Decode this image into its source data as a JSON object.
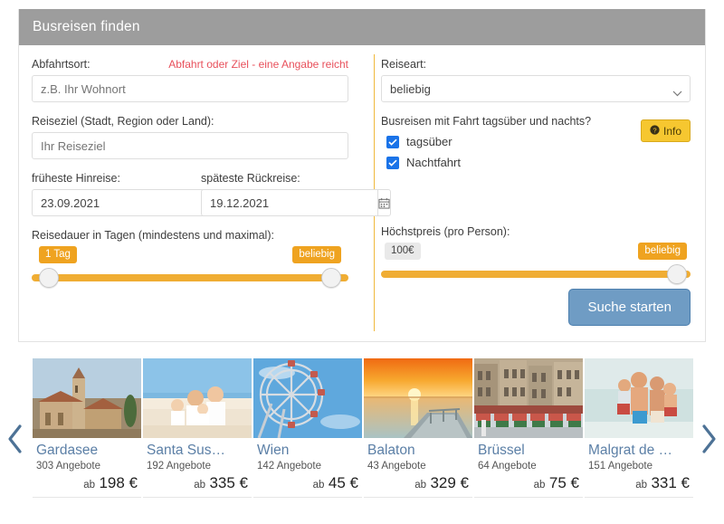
{
  "panel": {
    "header_title": "Busreisen finden"
  },
  "form": {
    "departure": {
      "label": "Abfahrtsort:",
      "warning": "Abfahrt oder Ziel - eine Angabe reicht",
      "placeholder": "z.B. Ihr Wohnort",
      "value": ""
    },
    "destination": {
      "label": "Reiseziel (Stadt, Region oder Land):",
      "placeholder": "Ihr Reiseziel",
      "value": ""
    },
    "date_from": {
      "label": "früheste Hinreise:",
      "value": "23.09.2021",
      "icon": "calendar-icon"
    },
    "date_to": {
      "label": "späteste Rückreise:",
      "value": "19.12.2021",
      "icon": "calendar-icon"
    },
    "duration": {
      "label": "Reisedauer in Tagen (mindestens und maximal):",
      "min_badge": "1 Tag",
      "max_badge": "beliebig"
    },
    "travel_type": {
      "label": "Reiseart:",
      "selected": "beliebig",
      "options": [
        "beliebig"
      ]
    },
    "daynight": {
      "question": "Busreisen mit Fahrt tagsüber und nachts?",
      "options": [
        {
          "label": "tagsüber",
          "checked": true
        },
        {
          "label": "Nachtfahrt",
          "checked": true
        }
      ],
      "info_button": "Info",
      "info_icon": "question-circle-icon"
    },
    "max_price": {
      "label": "Höchstpreis (pro Person):",
      "min_badge": "100€",
      "max_badge": "beliebig"
    },
    "submit_label": "Suche starten"
  },
  "carousel": {
    "prev_icon": "chevron-left-icon",
    "next_icon": "chevron-right-icon",
    "cards": [
      {
        "title": "Gardasee",
        "offers": "303 Angebote",
        "from": "ab",
        "price": "198 €",
        "image": "italian-village-church"
      },
      {
        "title": "Santa Sus…",
        "offers": "192 Angebote",
        "from": "ab",
        "price": "335 €",
        "image": "family-on-beach"
      },
      {
        "title": "Wien",
        "offers": "142 Angebote",
        "from": "ab",
        "price": "45 €",
        "image": "ferris-wheel"
      },
      {
        "title": "Balaton",
        "offers": "43 Angebote",
        "from": "ab",
        "price": "329 €",
        "image": "sunset-pier"
      },
      {
        "title": "Brüssel",
        "offers": "64 Angebote",
        "from": "ab",
        "price": "75 €",
        "image": "grand-place-buildings"
      },
      {
        "title": "Malgrat de …",
        "offers": "151 Angebote",
        "from": "ab",
        "price": "331 €",
        "image": "family-beach-sea"
      }
    ]
  },
  "colors": {
    "header_gray": "#9d9d9d",
    "accent_orange": "#f0ad33",
    "warning_red": "#e8505b",
    "checkbox_blue": "#1a73e8",
    "button_blue": "#6f9cc4",
    "info_yellow": "#f6c730",
    "card_title_blue": "#5b7fa6"
  }
}
